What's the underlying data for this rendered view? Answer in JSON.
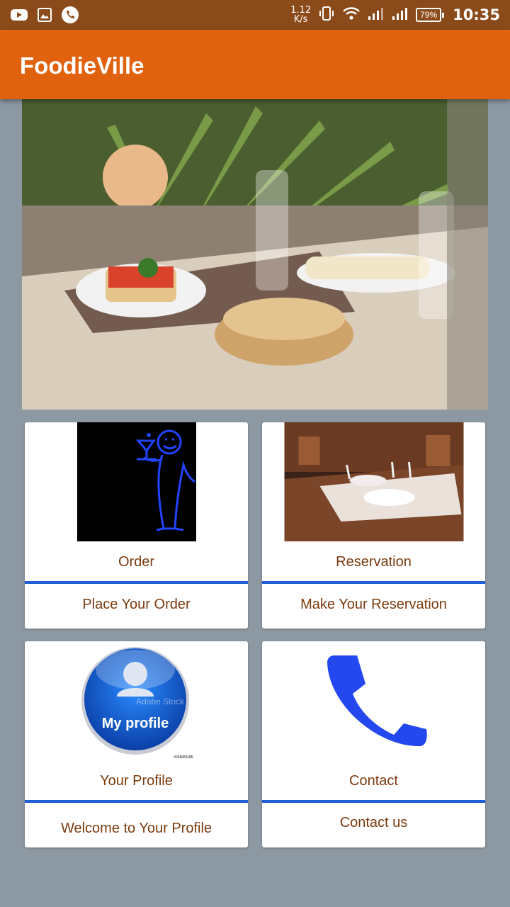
{
  "status_bar": {
    "speed_top": "1.12",
    "speed_bottom": "K/s",
    "battery": "79%",
    "time": "10:35",
    "icons": [
      "youtube-icon",
      "gallery-icon",
      "phone-call-icon",
      "vibrate-icon",
      "wifi-icon",
      "signal-icon",
      "signal-icon"
    ]
  },
  "app_bar": {
    "title": "FoodieVille"
  },
  "cards": [
    {
      "title": "Order",
      "subtitle": "Place Your Order"
    },
    {
      "title": "Reservation",
      "subtitle": "Make Your Reservation"
    },
    {
      "title": "Your Profile",
      "subtitle": "Welcome to Your Profile",
      "badge_text": "My profile",
      "watermark": "Adobe Stock",
      "small_id": "#246081185"
    },
    {
      "title": "Contact",
      "subtitle": "Contact us"
    }
  ],
  "colors": {
    "status_bar": "#8a4a1a",
    "app_bar": "#e0620f",
    "background": "#8c98a2",
    "divider": "#1f5fd6",
    "card_text": "#7a3a0e"
  }
}
